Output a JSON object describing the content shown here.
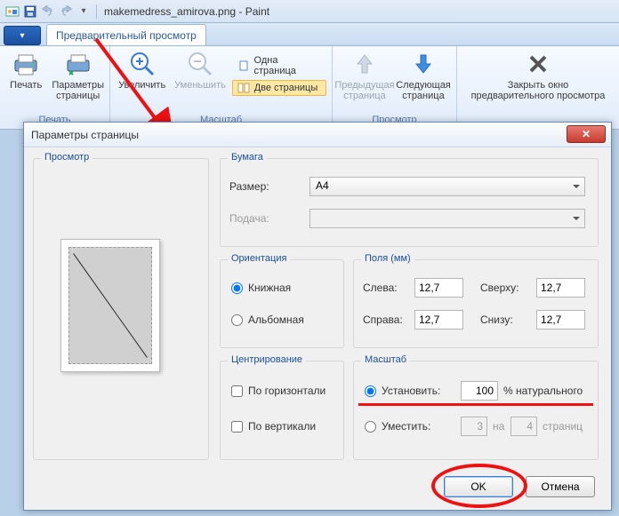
{
  "app": {
    "title": "makemedress_amirova.png - Paint"
  },
  "ribbon": {
    "file_glyph": "▾",
    "tab_label": "Предварительный просмотр",
    "groups": {
      "print": {
        "label": "Печать",
        "print_btn": "Печать",
        "page_setup_btn": "Параметры\nстраницы"
      },
      "zoom": {
        "label": "Масштаб",
        "zoom_in": "Увеличить",
        "zoom_out": "Уменьшить",
        "one_page": "Одна страница",
        "two_pages": "Две страницы"
      },
      "view": {
        "label": "Просмотр",
        "prev_page": "Предыдущая\nстраница",
        "next_page": "Следующая\nстраница"
      },
      "close": {
        "label": "",
        "close_btn": "Закрыть окно\nпредварительного просмотра"
      }
    }
  },
  "dialog": {
    "title": "Параметры страницы",
    "preview_legend": "Просмотр",
    "paper": {
      "legend": "Бумага",
      "size_label": "Размер:",
      "size_value": "A4",
      "source_label": "Подача:",
      "source_value": ""
    },
    "orientation": {
      "legend": "Ориентация",
      "portrait": "Книжная",
      "landscape": "Альбомная",
      "selected": "portrait"
    },
    "margins": {
      "legend": "Поля (мм)",
      "left_label": "Слева:",
      "left_value": "12,7",
      "right_label": "Справа:",
      "right_value": "12,7",
      "top_label": "Сверху:",
      "top_value": "12,7",
      "bottom_label": "Снизу:",
      "bottom_value": "12,7"
    },
    "centering": {
      "legend": "Центрирование",
      "horizontal": "По горизонтали",
      "vertical": "По вертикали"
    },
    "scaling": {
      "legend": "Масштаб",
      "adjust_label": "Установить:",
      "adjust_value": "100",
      "adjust_suffix": "% натурального",
      "fit_label": "Уместить:",
      "fit_cols": "3",
      "fit_by": "на",
      "fit_rows": "4",
      "fit_suffix": "страниц",
      "selected": "adjust"
    },
    "buttons": {
      "ok": "OK",
      "cancel": "Отмена"
    }
  }
}
